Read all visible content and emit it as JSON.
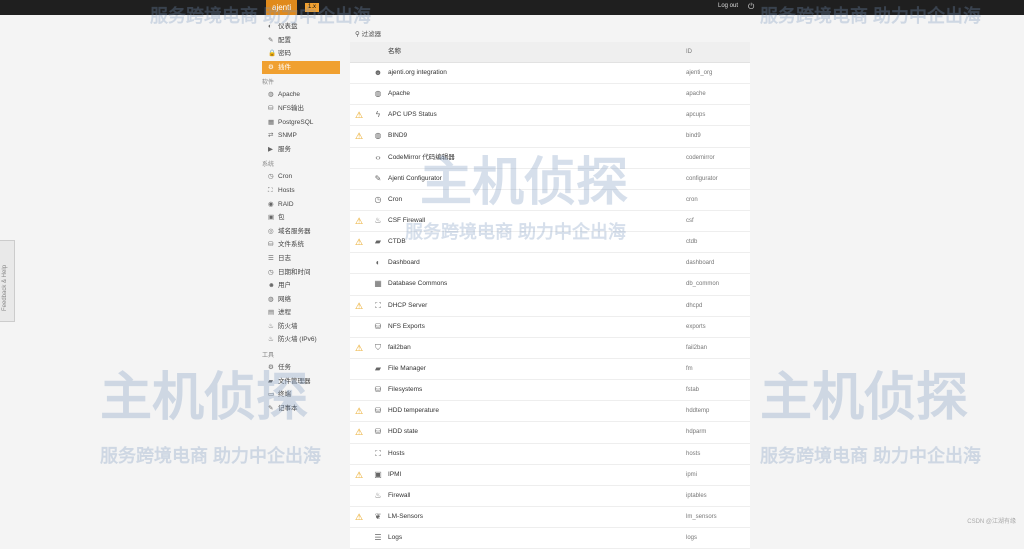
{
  "topbar": {
    "brand": "ajenti",
    "badge": "1.x",
    "logout": "Log out",
    "power_icon": "power-icon"
  },
  "sidebar": {
    "top_items": [
      {
        "label": "仪表盘",
        "icon": "dashboard-icon",
        "glyph": "◐"
      },
      {
        "label": "配置",
        "icon": "wrench-icon",
        "glyph": "✎"
      },
      {
        "label": "密码",
        "icon": "lock-icon",
        "glyph": "🔒"
      },
      {
        "label": "插件",
        "icon": "plugins-icon",
        "glyph": "⚙",
        "active": true
      }
    ],
    "section_software": "软件",
    "software_items": [
      {
        "label": "Apache",
        "icon": "globe-icon",
        "glyph": "◍"
      },
      {
        "label": "NFS输出",
        "icon": "nfs-icon",
        "glyph": "⛁"
      },
      {
        "label": "PostgreSQL",
        "icon": "table-icon",
        "glyph": "▦"
      },
      {
        "label": "SNMP",
        "icon": "exchange-icon",
        "glyph": "⇄"
      },
      {
        "label": "服务",
        "icon": "play-icon",
        "glyph": "▶"
      }
    ],
    "section_system": "系统",
    "system_items": [
      {
        "label": "Cron",
        "icon": "clock-icon",
        "glyph": "◷"
      },
      {
        "label": "Hosts",
        "icon": "sitemap-icon",
        "glyph": "⛶"
      },
      {
        "label": "RAID",
        "icon": "disk-icon",
        "glyph": "◉"
      },
      {
        "label": "包",
        "icon": "gift-icon",
        "glyph": "▣"
      },
      {
        "label": "域名服务器",
        "icon": "dns-icon",
        "glyph": "◎"
      },
      {
        "label": "文件系统",
        "icon": "hdd-icon",
        "glyph": "⛁"
      },
      {
        "label": "日志",
        "icon": "list-icon",
        "glyph": "☰"
      },
      {
        "label": "日期和时间",
        "icon": "time-icon",
        "glyph": "◷"
      },
      {
        "label": "用户",
        "icon": "users-icon",
        "glyph": "☻"
      },
      {
        "label": "网络",
        "icon": "network-icon",
        "glyph": "◍"
      },
      {
        "label": "进程",
        "icon": "process-icon",
        "glyph": "▤"
      },
      {
        "label": "防火墙",
        "icon": "fire-icon",
        "glyph": "♨"
      },
      {
        "label": "防火墙 (IPv6)",
        "icon": "fire-icon",
        "glyph": "♨"
      }
    ],
    "section_tools": "工具",
    "tools_items": [
      {
        "label": "任务",
        "icon": "cog-icon",
        "glyph": "⚙"
      },
      {
        "label": "文件管理器",
        "icon": "folder-icon",
        "glyph": "▰"
      },
      {
        "label": "终端",
        "icon": "terminal-icon",
        "glyph": "▭"
      },
      {
        "label": "记事本",
        "icon": "edit-icon",
        "glyph": "✎"
      }
    ]
  },
  "filter": {
    "label": "过滤器",
    "icon": "search-icon"
  },
  "table": {
    "headers": {
      "name": "名称",
      "id": "ID"
    },
    "rows": [
      {
        "warn": false,
        "glyph": "☻",
        "icon": "users-icon",
        "name": "ajenti.org integration",
        "id": "ajenti_org"
      },
      {
        "warn": false,
        "glyph": "◍",
        "icon": "globe-icon",
        "name": "Apache",
        "id": "apache"
      },
      {
        "warn": true,
        "glyph": "ϟ",
        "icon": "bolt-icon",
        "name": "APC UPS Status",
        "id": "apcups"
      },
      {
        "warn": true,
        "glyph": "◍",
        "icon": "globe-icon",
        "name": "BIND9",
        "id": "bind9"
      },
      {
        "warn": false,
        "glyph": "‹›",
        "icon": "code-icon",
        "name": "CodeMirror 代码编辑器",
        "id": "codemirror"
      },
      {
        "warn": false,
        "glyph": "✎",
        "icon": "wrench-icon",
        "name": "Ajenti Configurator",
        "id": "configurator"
      },
      {
        "warn": false,
        "glyph": "◷",
        "icon": "clock-icon",
        "name": "Cron",
        "id": "cron"
      },
      {
        "warn": true,
        "glyph": "♨",
        "icon": "fire-icon",
        "name": "CSF Firewall",
        "id": "csf"
      },
      {
        "warn": true,
        "glyph": "▰",
        "icon": "folder-icon",
        "name": "CTDB",
        "id": "ctdb"
      },
      {
        "warn": false,
        "glyph": "◐",
        "icon": "dashboard-icon",
        "name": "Dashboard",
        "id": "dashboard"
      },
      {
        "warn": false,
        "glyph": "▦",
        "icon": "table-icon",
        "name": "Database Commons",
        "id": "db_common"
      },
      {
        "warn": true,
        "glyph": "⛶",
        "icon": "sitemap-icon",
        "name": "DHCP Server",
        "id": "dhcpd"
      },
      {
        "warn": false,
        "glyph": "⛁",
        "icon": "hdd-icon",
        "name": "NFS Exports",
        "id": "exports"
      },
      {
        "warn": true,
        "glyph": "⛉",
        "icon": "shield-icon",
        "name": "fail2ban",
        "id": "fail2ban"
      },
      {
        "warn": false,
        "glyph": "▰",
        "icon": "folder-icon",
        "name": "File Manager",
        "id": "fm"
      },
      {
        "warn": false,
        "glyph": "⛁",
        "icon": "hdd-icon",
        "name": "Filesystems",
        "id": "fstab"
      },
      {
        "warn": true,
        "glyph": "⛁",
        "icon": "hdd-icon",
        "name": "HDD temperature",
        "id": "hddtemp"
      },
      {
        "warn": true,
        "glyph": "⛁",
        "icon": "hdd-icon",
        "name": "HDD state",
        "id": "hdparm"
      },
      {
        "warn": false,
        "glyph": "⛶",
        "icon": "sitemap-icon",
        "name": "Hosts",
        "id": "hosts"
      },
      {
        "warn": true,
        "glyph": "▣",
        "icon": "server-icon",
        "name": "IPMI",
        "id": "ipmi"
      },
      {
        "warn": false,
        "glyph": "♨",
        "icon": "fire-icon",
        "name": "Firewall",
        "id": "iptables"
      },
      {
        "warn": true,
        "glyph": "❦",
        "icon": "leaf-icon",
        "name": "LM-Sensors",
        "id": "lm_sensors"
      },
      {
        "warn": false,
        "glyph": "☰",
        "icon": "list-icon",
        "name": "Logs",
        "id": "logs"
      }
    ]
  },
  "feedback": {
    "label": "Feedback & Help"
  },
  "watermarks": {
    "line1": "服务跨境电商 助力中企出海",
    "logo": "主机侦探"
  },
  "footer": {
    "credit": "CSDN @江湖有缘"
  }
}
